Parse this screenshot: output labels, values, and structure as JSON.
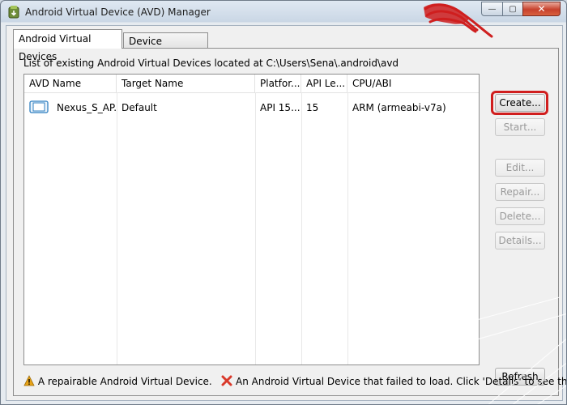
{
  "window": {
    "title": "Android Virtual Device (AVD) Manager",
    "controls": {
      "minimize": "—",
      "maximize": "▢",
      "close": "✕"
    }
  },
  "tabs": [
    {
      "label": "Android Virtual Devices",
      "selected": true
    },
    {
      "label": "Device Definitions",
      "selected": false
    }
  ],
  "location_text": "List of existing Android Virtual Devices located at C:\\Users\\Sena\\.android\\avd",
  "table": {
    "columns": [
      "AVD Name",
      "Target Name",
      "Platfor...",
      "API Le...",
      "CPU/ABI"
    ],
    "rows": [
      {
        "avd_name": "Nexus_S_AP...",
        "target": "Default",
        "platform": "API 15...",
        "api_level": "15",
        "cpu": "ARM (armeabi-v7a)"
      }
    ]
  },
  "buttons": {
    "create": "Create...",
    "start": "Start...",
    "edit": "Edit...",
    "repair": "Repair...",
    "delete": "Delete...",
    "details": "Details...",
    "refresh": "Refresh"
  },
  "status": {
    "repairable": "A repairable Android Virtual Device.",
    "failed": "An Android Virtual Device that failed to load. Click 'Details' to see the error."
  },
  "colors": {
    "highlight_ring": "#d01e1e",
    "pointer_hand": "#cf1f1f",
    "warning": "#e8a317",
    "error": "#d9392b"
  },
  "icons": {
    "app": "android-sdk-icon",
    "device": "device-icon",
    "warning": "warning-icon",
    "error": "error-x-icon",
    "annotation": "pointing-hand-icon"
  }
}
